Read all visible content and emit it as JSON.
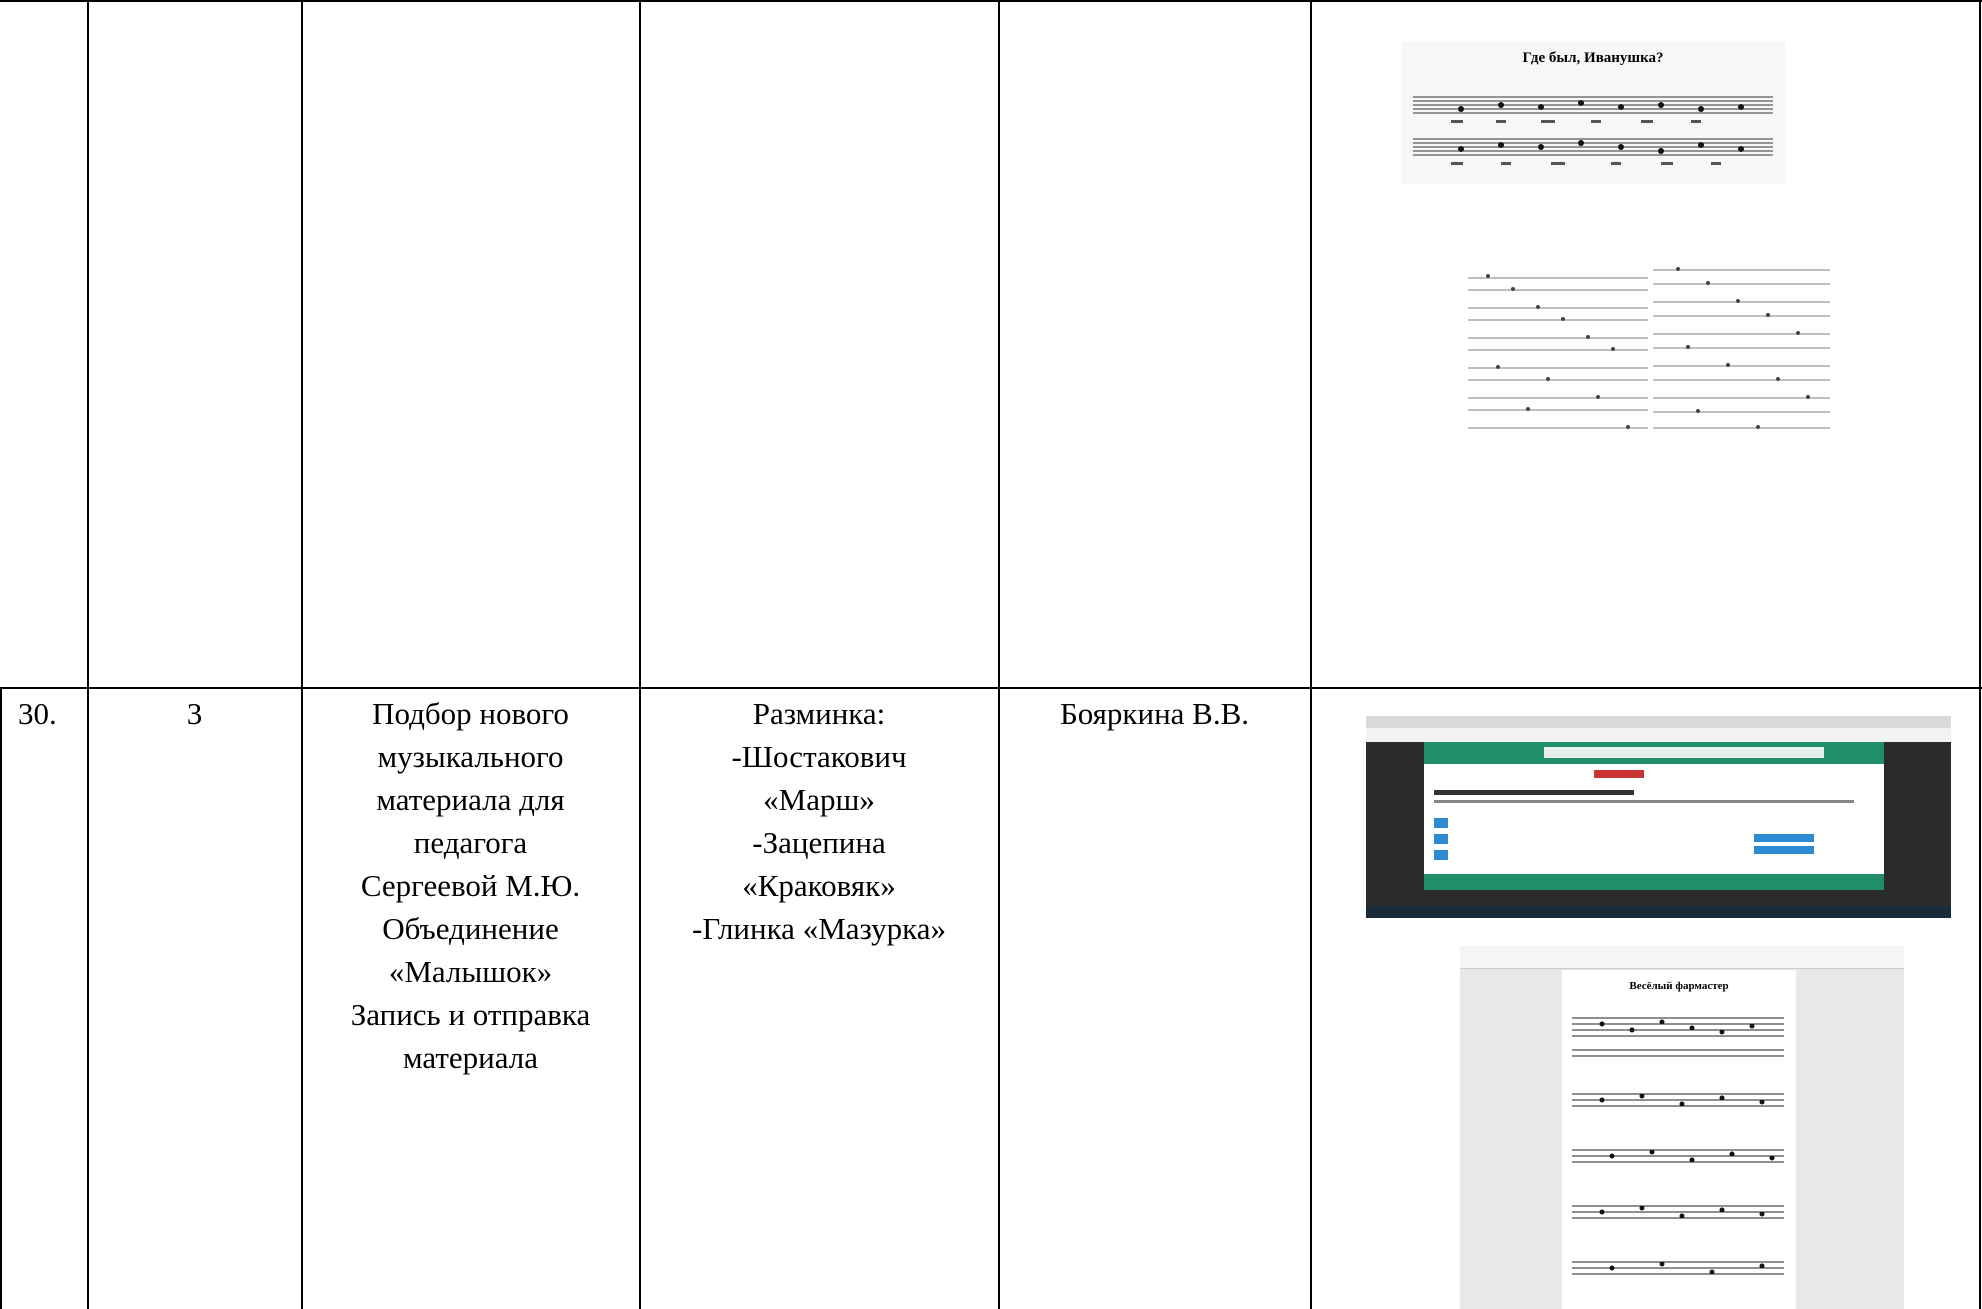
{
  "table": {
    "row30": {
      "number": "30.",
      "grade": "3",
      "activity": [
        "Подбор нового",
        "музыкального",
        "материала для",
        "педагога",
        "Сергеевой М.Ю.",
        "Объединение",
        "«Малышок»",
        "Запись и отправка",
        "материала"
      ],
      "repertoire": [
        "Разминка:",
        "-Шостакович",
        "«Марш»",
        "-Зацепина",
        "«Краковяк»",
        "-Глинка «Мазурка»"
      ],
      "teacher": "Бояркина В.В."
    }
  },
  "images": {
    "score1_title": "Где был, Иванушка?",
    "score3_title": "Весёлый фармастер"
  },
  "colors": {
    "border": "#000000",
    "site_header": "#1e8f6a",
    "site_dark": "#2b2b2b",
    "viewer_bg": "#e8e8e8"
  }
}
